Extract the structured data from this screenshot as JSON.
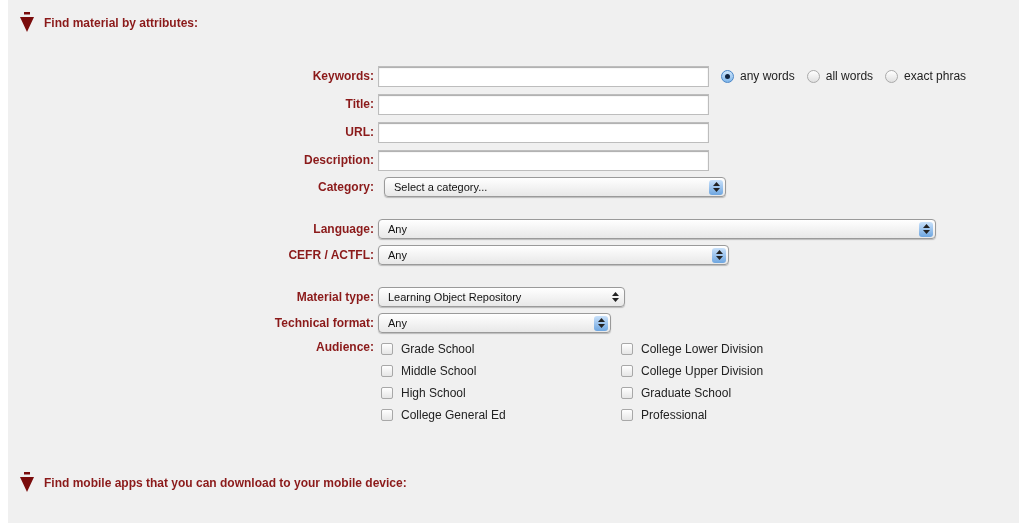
{
  "sections": [
    {
      "title": "Find material by attributes:",
      "expanded": true
    },
    {
      "title": "Find mobile apps that you can download to your mobile device:",
      "expanded": true
    }
  ],
  "groups": [
    {
      "fields": [
        {
          "kind": "text",
          "label": "Keywords:",
          "options": [
            {
              "label": "any words",
              "selected": true
            },
            {
              "label": "all words",
              "selected": false
            },
            {
              "label": "exact phras",
              "selected": false
            }
          ]
        },
        {
          "kind": "text",
          "label": "Title:"
        },
        {
          "kind": "text",
          "label": "URL:"
        },
        {
          "kind": "text",
          "label": "Description:"
        },
        {
          "kind": "select",
          "label": "Category:",
          "value": "Select a category...",
          "plain": false
        }
      ]
    },
    {
      "fields": [
        {
          "kind": "select",
          "label": "Language:",
          "value": "Any",
          "plain": false
        },
        {
          "kind": "select",
          "label": "CEFR / ACTFL:",
          "value": "Any",
          "plain": false
        }
      ]
    },
    {
      "fields": [
        {
          "kind": "select",
          "label": "Material type:",
          "value": "Learning Object Repository",
          "plain": true
        },
        {
          "kind": "select",
          "label": "Technical format:",
          "value": "Any",
          "plain": false
        },
        {
          "kind": "checks",
          "label": "Audience:",
          "columns": [
            [
              {
                "label": "Grade School",
                "checked": false
              },
              {
                "label": "Middle School",
                "checked": false
              },
              {
                "label": "High School",
                "checked": false
              },
              {
                "label": "College General Ed",
                "checked": false
              }
            ],
            [
              {
                "label": "College Lower Division",
                "checked": false
              },
              {
                "label": "College Upper Division",
                "checked": false
              },
              {
                "label": "Graduate School",
                "checked": false
              },
              {
                "label": "Professional",
                "checked": false
              }
            ]
          ]
        }
      ]
    }
  ]
}
